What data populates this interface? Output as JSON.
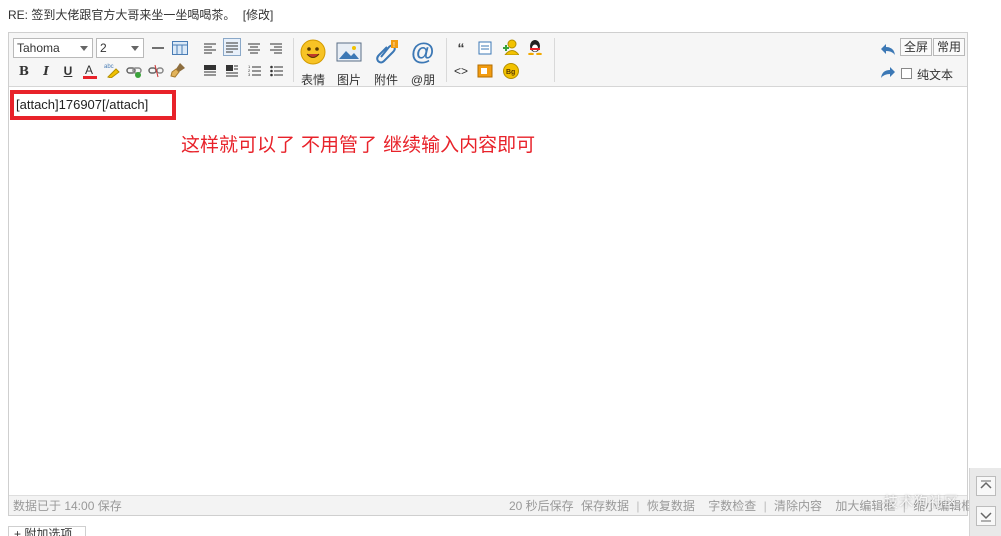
{
  "reply": {
    "title": "RE: 签到大佬跟官方大哥来坐一坐喝喝茶。",
    "edit_link": "[修改]"
  },
  "toolbar": {
    "font_family": "Tahoma",
    "font_size": "2",
    "emoji_label": "表情",
    "image_label": "图片",
    "attach_label": "附件",
    "mention_label": "@朋",
    "bold": "B",
    "italic": "I",
    "underline": "U",
    "fullscreen_label": "全屏",
    "common_label": "常用",
    "plaintext_label": "纯文本"
  },
  "content": {
    "attach_code": "[attach]176907[/attach]",
    "annotation": "这样就可以了 不用管了 继续输入内容即可"
  },
  "status": {
    "saved": "数据已于 14:00 保存",
    "autosave": "20 秒后保存",
    "save_data": "保存数据",
    "restore_data": "恢复数据",
    "word_check": "字数检查",
    "clear_content": "清除内容",
    "enlarge_editor": "加大编辑框",
    "shrink_editor": "缩小编辑框"
  },
  "extra": {
    "tab_label": "附加选项"
  },
  "watermark": "技术狗社区",
  "colors": {
    "accent_red": "#e8222a",
    "link_blue": "#336699",
    "toolbar_bg": "#f6f6f6"
  }
}
